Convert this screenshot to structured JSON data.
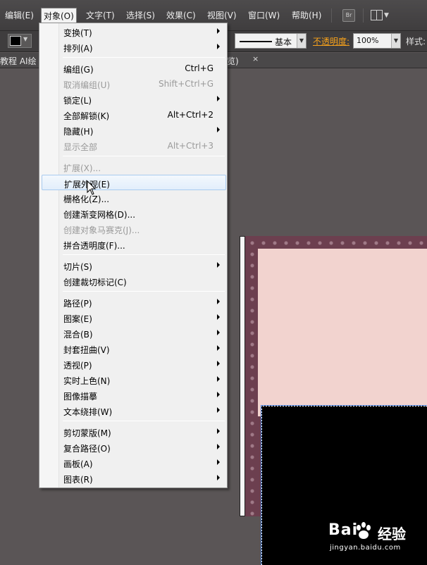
{
  "menubar": {
    "items": [
      "编辑(E)",
      "对象(O)",
      "文字(T)",
      "选择(S)",
      "效果(C)",
      "视图(V)",
      "窗口(W)",
      "帮助(H)"
    ],
    "bridge_label": "Br"
  },
  "controlbar": {
    "fill_color": "#000000",
    "stroke_profile": "基本",
    "opacity_label": "不透明度:",
    "opacity_value": "100%",
    "style_label": "样式:"
  },
  "tabs": {
    "left_text": "教程 AI绘",
    "right_text": "览)",
    "close_glyph": "×"
  },
  "object_menu": {
    "groups": [
      [
        {
          "label": "变换(T)",
          "submenu": true
        },
        {
          "label": "排列(A)",
          "submenu": true
        }
      ],
      [
        {
          "label": "编组(G)",
          "shortcut": "Ctrl+G"
        },
        {
          "label": "取消编组(U)",
          "shortcut": "Shift+Ctrl+G",
          "disabled": true
        },
        {
          "label": "锁定(L)",
          "submenu": true
        },
        {
          "label": "全部解锁(K)",
          "shortcut": "Alt+Ctrl+2"
        },
        {
          "label": "隐藏(H)",
          "submenu": true
        },
        {
          "label": "显示全部",
          "shortcut": "Alt+Ctrl+3",
          "disabled": true
        }
      ],
      [
        {
          "label": "扩展(X)...",
          "disabled": true
        },
        {
          "label": "扩展外观(E)",
          "highlighted": true
        },
        {
          "label": "栅格化(Z)..."
        },
        {
          "label": "创建渐变网格(D)..."
        },
        {
          "label": "创建对象马赛克(J)...",
          "disabled": true
        },
        {
          "label": "拼合透明度(F)..."
        }
      ],
      [
        {
          "label": "切片(S)",
          "submenu": true
        },
        {
          "label": "创建裁切标记(C)"
        }
      ],
      [
        {
          "label": "路径(P)",
          "submenu": true
        },
        {
          "label": "图案(E)",
          "submenu": true
        },
        {
          "label": "混合(B)",
          "submenu": true
        },
        {
          "label": "封套扭曲(V)",
          "submenu": true
        },
        {
          "label": "透视(P)",
          "submenu": true
        },
        {
          "label": "实时上色(N)",
          "submenu": true
        },
        {
          "label": "图像描摹",
          "submenu": true
        },
        {
          "label": "文本绕排(W)",
          "submenu": true
        }
      ],
      [
        {
          "label": "剪切蒙版(M)",
          "submenu": true
        },
        {
          "label": "复合路径(O)",
          "submenu": true
        },
        {
          "label": "画板(A)",
          "submenu": true
        },
        {
          "label": "图表(R)",
          "submenu": true
        }
      ]
    ]
  },
  "watermark": {
    "brand_left": "Bai",
    "brand_right": "经验",
    "url": "jingyan.baidu.com"
  },
  "colors": {
    "menubar_bg": "#454344",
    "canvas_bg": "#5a5556",
    "opacity_accent": "#f7a21b",
    "menu_highlight_border": "#a9cbef",
    "artboard_border": "#6c3f4f",
    "artboard_pink": "#f2d3cf"
  }
}
